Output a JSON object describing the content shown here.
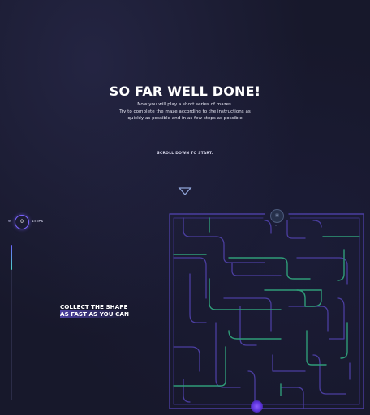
{
  "intro": {
    "title": "SO FAR WELL DONE!",
    "line1": "Now you will play a short series of mazes.",
    "line2": "Try to complete the maze according to the instructions as",
    "line3": "quickly as possible and in as few steps as possible",
    "scroll_hint": "SCROLL DOWN TO START."
  },
  "hud": {
    "step_count": "0",
    "steps_label": "STEPS",
    "progress": 0.16
  },
  "instruction": {
    "line1": "COLLECT THE SHAPE",
    "line2": "AS FAST AS YOU CAN"
  },
  "maze": {
    "target_icon": "shape-icon",
    "player_icon": "orb-icon"
  },
  "colors": {
    "background": "#17182b",
    "maze_wall": "#4b3ea0",
    "maze_path_green": "#2f9c78",
    "accent_purple": "#7b64ff"
  }
}
